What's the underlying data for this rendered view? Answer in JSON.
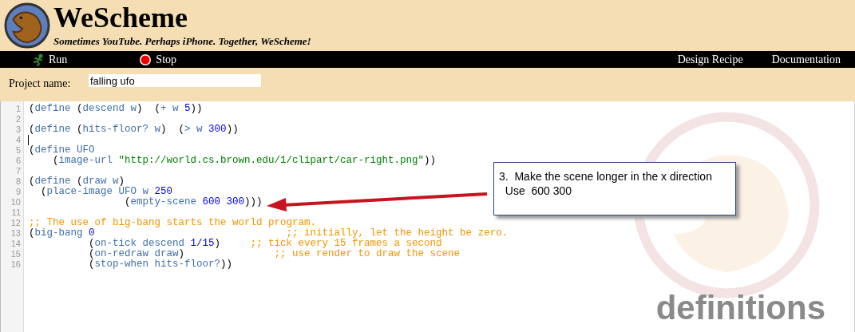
{
  "header": {
    "title": "WeScheme",
    "tagline": "Sometimes YouTube. Perhaps iPhone. Together, WeScheme!"
  },
  "toolbar": {
    "actions": [
      {
        "label": "Run",
        "kind": "run"
      },
      {
        "label": "Stop",
        "kind": "stop"
      }
    ],
    "links": [
      "Design Recipe",
      "Documentation"
    ]
  },
  "project": {
    "label": "Project name:",
    "value": "falling ufo"
  },
  "editor": {
    "lines": [
      {
        "number": "1",
        "cursor": false,
        "tokens": [
          {
            "kind": "p",
            "text": "("
          },
          {
            "kind": "id",
            "text": "define"
          },
          {
            "kind": "p",
            "text": " ("
          },
          {
            "kind": "id",
            "text": "descend w"
          },
          {
            "kind": "p",
            "text": ")  ("
          },
          {
            "kind": "id",
            "text": "+ w "
          },
          {
            "kind": "num",
            "text": "5"
          },
          {
            "kind": "p",
            "text": "))"
          }
        ]
      },
      {
        "number": "2",
        "cursor": false
      },
      {
        "number": "3",
        "cursor": false,
        "tokens": [
          {
            "kind": "p",
            "text": "("
          },
          {
            "kind": "id",
            "text": "define"
          },
          {
            "kind": "p",
            "text": " ("
          },
          {
            "kind": "id",
            "text": "hits-floor? w"
          },
          {
            "kind": "p",
            "text": ")  ("
          },
          {
            "kind": "id",
            "text": "> w "
          },
          {
            "kind": "num",
            "text": "300"
          },
          {
            "kind": "p",
            "text": "))"
          }
        ]
      },
      {
        "number": "4",
        "cursor": true
      },
      {
        "number": "5",
        "cursor": false,
        "tokens": [
          {
            "kind": "p",
            "text": "("
          },
          {
            "kind": "id",
            "text": "define UFO"
          }
        ]
      },
      {
        "number": "6",
        "cursor": false,
        "tokens": [
          {
            "kind": "p",
            "text": "    ("
          },
          {
            "kind": "id",
            "text": "image-url "
          },
          {
            "kind": "str",
            "text": "\"http://world.cs.brown.edu/1/clipart/car-right.png\""
          },
          {
            "kind": "p",
            "text": "))"
          }
        ]
      },
      {
        "number": "7",
        "cursor": false
      },
      {
        "number": "8",
        "cursor": false,
        "tokens": [
          {
            "kind": "p",
            "text": "("
          },
          {
            "kind": "id",
            "text": "define"
          },
          {
            "kind": "p",
            "text": " ("
          },
          {
            "kind": "id",
            "text": "draw w"
          },
          {
            "kind": "p",
            "text": ")"
          }
        ]
      },
      {
        "number": "9",
        "cursor": false,
        "tokens": [
          {
            "kind": "p",
            "text": "  ("
          },
          {
            "kind": "id",
            "text": "place-image UFO w "
          },
          {
            "kind": "num",
            "text": "250"
          }
        ]
      },
      {
        "number": "10",
        "cursor": false,
        "tokens": [
          {
            "kind": "p",
            "text": "                ("
          },
          {
            "kind": "id",
            "text": "empty-scene "
          },
          {
            "kind": "num",
            "text": "600 300"
          },
          {
            "kind": "p",
            "text": ")))"
          }
        ]
      },
      {
        "number": "11",
        "cursor": false
      },
      {
        "number": "12",
        "cursor": false,
        "tokens": [
          {
            "kind": "cmt",
            "text": ";; The use of big-bang starts the world program."
          }
        ]
      },
      {
        "number": "13",
        "cursor": false,
        "tokens": [
          {
            "kind": "p",
            "text": "("
          },
          {
            "kind": "id",
            "text": "big-bang "
          },
          {
            "kind": "num",
            "text": "0"
          },
          {
            "kind": "cmt",
            "text": "                                ;; initially, let the height be zero."
          }
        ]
      },
      {
        "number": "14",
        "cursor": false,
        "tokens": [
          {
            "kind": "p",
            "text": "          ("
          },
          {
            "kind": "id",
            "text": "on-tick descend "
          },
          {
            "kind": "num",
            "text": "1/15"
          },
          {
            "kind": "p",
            "text": ")"
          },
          {
            "kind": "cmt",
            "text": "     ;; tick every 15 frames a second"
          }
        ]
      },
      {
        "number": "15",
        "cursor": false,
        "tokens": [
          {
            "kind": "p",
            "text": "          ("
          },
          {
            "kind": "id",
            "text": "on-redraw draw"
          },
          {
            "kind": "p",
            "text": ")"
          },
          {
            "kind": "cmt",
            "text": "               ;; use render to draw the scene"
          }
        ]
      },
      {
        "number": "16",
        "cursor": false,
        "tokens": [
          {
            "kind": "p",
            "text": "          ("
          },
          {
            "kind": "id",
            "text": "stop-when hits-floor?"
          },
          {
            "kind": "p",
            "text": "))"
          }
        ]
      }
    ]
  },
  "callout": {
    "text": "3.  Make the scene longer in the x direction\n  Use  600 300"
  },
  "overlay_label": "definitions"
}
